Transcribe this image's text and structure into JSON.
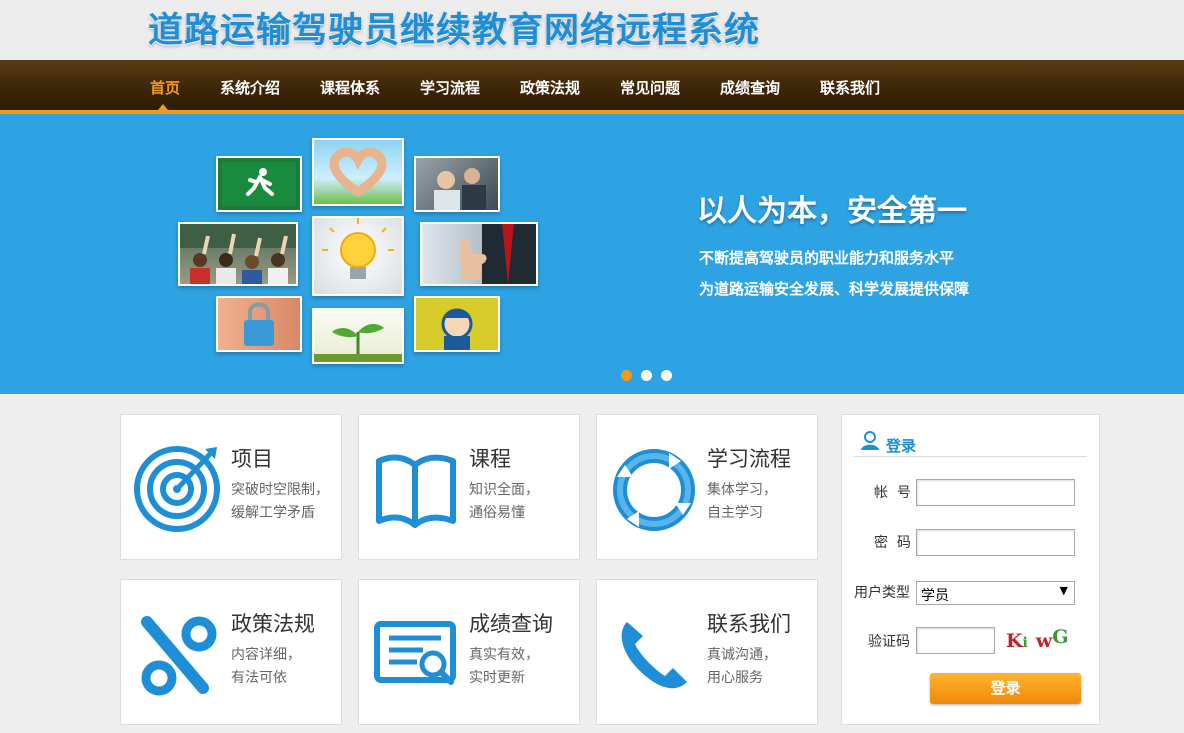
{
  "header": {
    "site_title": "道路运输驾驶员继续教育网络远程系统"
  },
  "nav": {
    "items": [
      "首页",
      "系统介绍",
      "课程体系",
      "学习流程",
      "政策法规",
      "常见问题",
      "成绩查询",
      "联系我们"
    ],
    "active_index": 0
  },
  "banner": {
    "slogan": "以人为本，安全第一",
    "line1": "不断提高驾驶员的职业能力和服务水平",
    "line2": "为道路运输安全发展、科学发展提供保障",
    "active_slide": 0
  },
  "features": [
    {
      "title": "项目",
      "line1": "突破时空限制，",
      "line2": "缓解工学矛盾",
      "icon": "target-icon"
    },
    {
      "title": "课程",
      "line1": "知识全面，",
      "line2": "通俗易懂",
      "icon": "book-icon"
    },
    {
      "title": "学习流程",
      "line1": "集体学习，",
      "line2": "自主学习",
      "icon": "cycle-icon"
    },
    {
      "title": "政策法规",
      "line1": "内容详细，",
      "line2": "有法可依",
      "icon": "percent-icon"
    },
    {
      "title": "成绩查询",
      "line1": "真实有效，",
      "line2": "实时更新",
      "icon": "search-document-icon"
    },
    {
      "title": "联系我们",
      "line1": "真诚沟通，",
      "line2": "用心服务",
      "icon": "phone-icon"
    }
  ],
  "login": {
    "title": "登录",
    "account_label": "帐  号",
    "account_value": "",
    "password_label": "密  码",
    "password_value": "",
    "user_type_label": "用户类型",
    "user_type_value": "学员",
    "captcha_label": "验证码",
    "captcha_value": "",
    "captcha_text": "KiwG",
    "submit_label": "登录"
  },
  "colors": {
    "brand_blue": "#1e8ed6",
    "banner_blue": "#2ea3e3",
    "accent_orange": "#f29a1f",
    "nav_brown": "#3d2708"
  }
}
